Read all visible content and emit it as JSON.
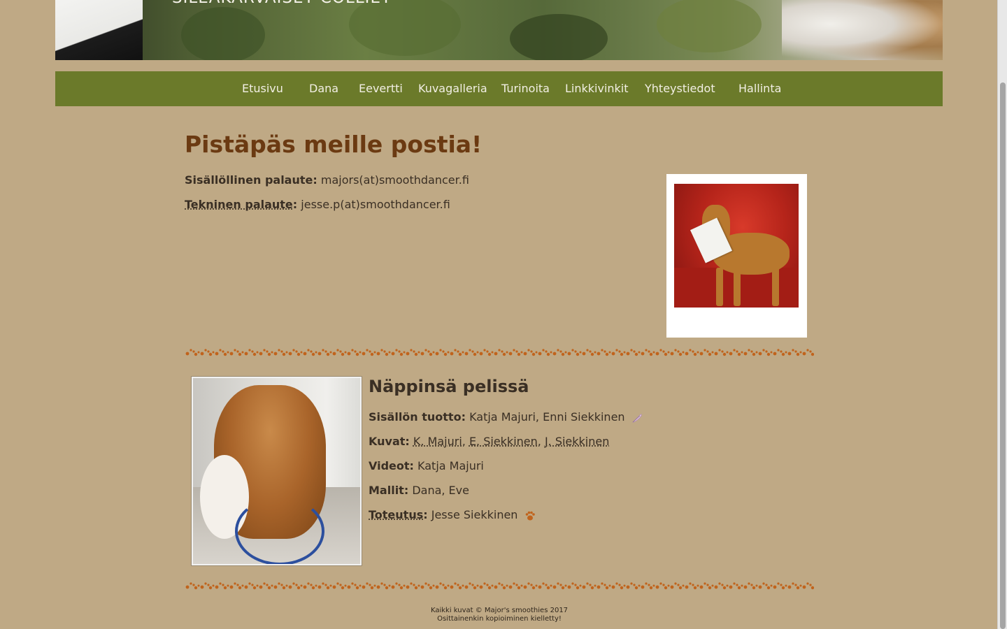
{
  "banner": {
    "title": "SILEÄKARVAISET COLLIET"
  },
  "nav": {
    "items": [
      {
        "label": "Etusivu"
      },
      {
        "label": "Dana"
      },
      {
        "label": "Eevertti"
      },
      {
        "label": "Kuvagalleria"
      },
      {
        "label": "Turinoita"
      },
      {
        "label": "Linkkivinkit"
      },
      {
        "label": "Yhteystiedot"
      },
      {
        "label": "Hallinta"
      }
    ]
  },
  "contact": {
    "title": "Pistäpäs meille postia!",
    "content_label": "Sisällöllinen palaute:",
    "content_value": "majors(at)smoothdancer.fi",
    "tech_label": "Tekninen palaute",
    "tech_colon": ":",
    "tech_value": "jesse.p(at)smoothdancer.fi"
  },
  "divider": {
    "pattern": "ఘ"
  },
  "credits": {
    "title": "Näppinsä pelissä",
    "content_label": "Sisällön tuotto:",
    "content_value": "Katja Majuri, Enni Siekkinen",
    "photos_label": "Kuvat:",
    "photographers": [
      "K. Majuri",
      "E. Siekkinen",
      "J. Siekkinen"
    ],
    "videos_label": "Videot:",
    "videos_value": "Katja Majuri",
    "models_label": "Mallit:",
    "models_value": "Dana, Eve",
    "impl_label": "Toteutus",
    "impl_colon": ":",
    "impl_value": "Jesse Siekkinen"
  },
  "footer": {
    "line1": "Kaikki kuvat © Major's smoothies 2017",
    "line2": "Osittainenkin kopioiminen kielletty!"
  },
  "colors": {
    "background": "#bfa985",
    "nav": "#6b7a2a",
    "title": "#6b3a12",
    "paw": "#c0631c"
  },
  "icons": {
    "feather": "feather-icon",
    "paw": "paw-icon"
  }
}
